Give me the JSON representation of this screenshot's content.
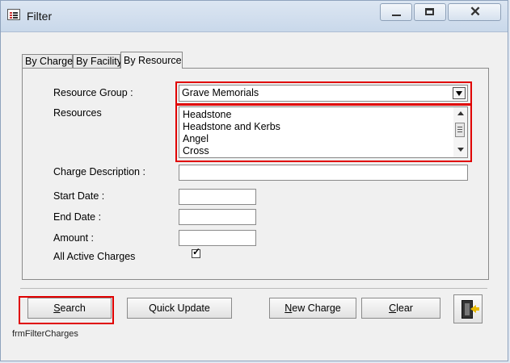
{
  "window": {
    "title": "Filter"
  },
  "tabs": [
    {
      "label": "By Charge"
    },
    {
      "label": "By Facility"
    },
    {
      "label": "By Resource"
    }
  ],
  "form": {
    "resource_group_label": "Resource Group :",
    "resource_group_value": "Grave Memorials",
    "resources_label": "Resources",
    "resources": [
      "Headstone",
      "Headstone and Kerbs",
      "Angel",
      "Cross"
    ],
    "charge_description_label": "Charge Description :",
    "start_date_label": "Start Date :",
    "end_date_label": "End Date :",
    "amount_label": "Amount :",
    "all_active_label": "All Active Charges",
    "all_active_checked": "✓"
  },
  "buttons": {
    "search": {
      "mnemonic": "S",
      "rest": "earch"
    },
    "quick_update": "Quick Update",
    "new_charge": {
      "mnemonic": "N",
      "rest": "ew Charge"
    },
    "clear": {
      "mnemonic": "C",
      "rest": "lear"
    }
  },
  "status": {
    "form_name": "frmFilterCharges"
  },
  "colors": {
    "highlight": "#e00000",
    "titlebar": "#c9d8ea"
  },
  "icons": {
    "app": "form-icon",
    "exit": "exit-door-icon"
  }
}
